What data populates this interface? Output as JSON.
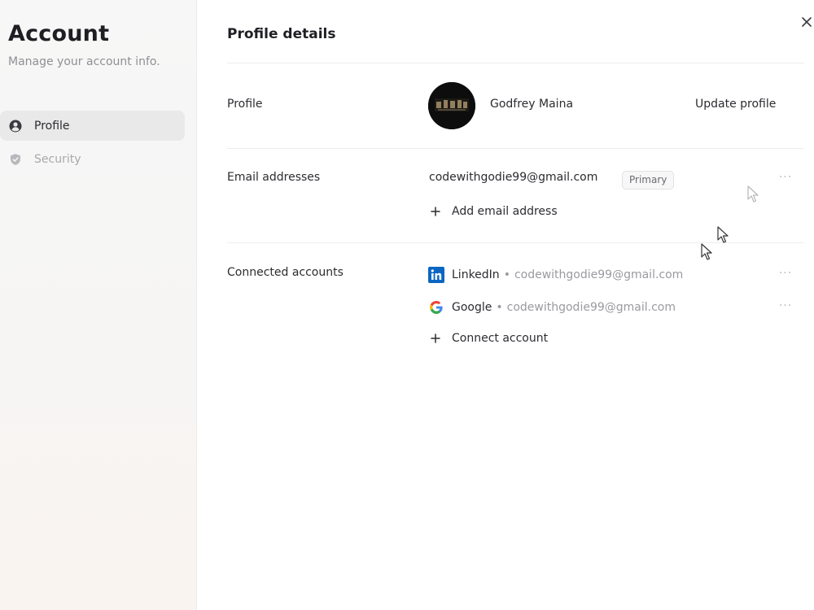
{
  "sidebar": {
    "title": "Account",
    "subtitle": "Manage your account info.",
    "items": [
      {
        "label": "Profile",
        "icon": "user-circle-icon",
        "active": true
      },
      {
        "label": "Security",
        "icon": "shield-icon",
        "active": false
      }
    ]
  },
  "main": {
    "title": "Profile details",
    "profile": {
      "label": "Profile",
      "name": "Godfrey Maina",
      "update_label": "Update profile"
    },
    "email": {
      "label": "Email addresses",
      "address": "codewithgodie99@gmail.com",
      "badge": "Primary",
      "add_label": "Add email address",
      "more": "···"
    },
    "connected": {
      "label": "Connected accounts",
      "accounts": [
        {
          "provider": "LinkedIn",
          "separator": "•",
          "email": "codewithgodie99@gmail.com",
          "icon": "linkedin-icon",
          "more": "···"
        },
        {
          "provider": "Google",
          "separator": "•",
          "email": "codewithgodie99@gmail.com",
          "icon": "google-icon",
          "more": "···"
        }
      ],
      "connect_label": "Connect account"
    }
  },
  "colors": {
    "linkedin": "#0A66C2",
    "sidebar_bg": "#f6f6f6",
    "active_nav": "#e9e9ea"
  }
}
